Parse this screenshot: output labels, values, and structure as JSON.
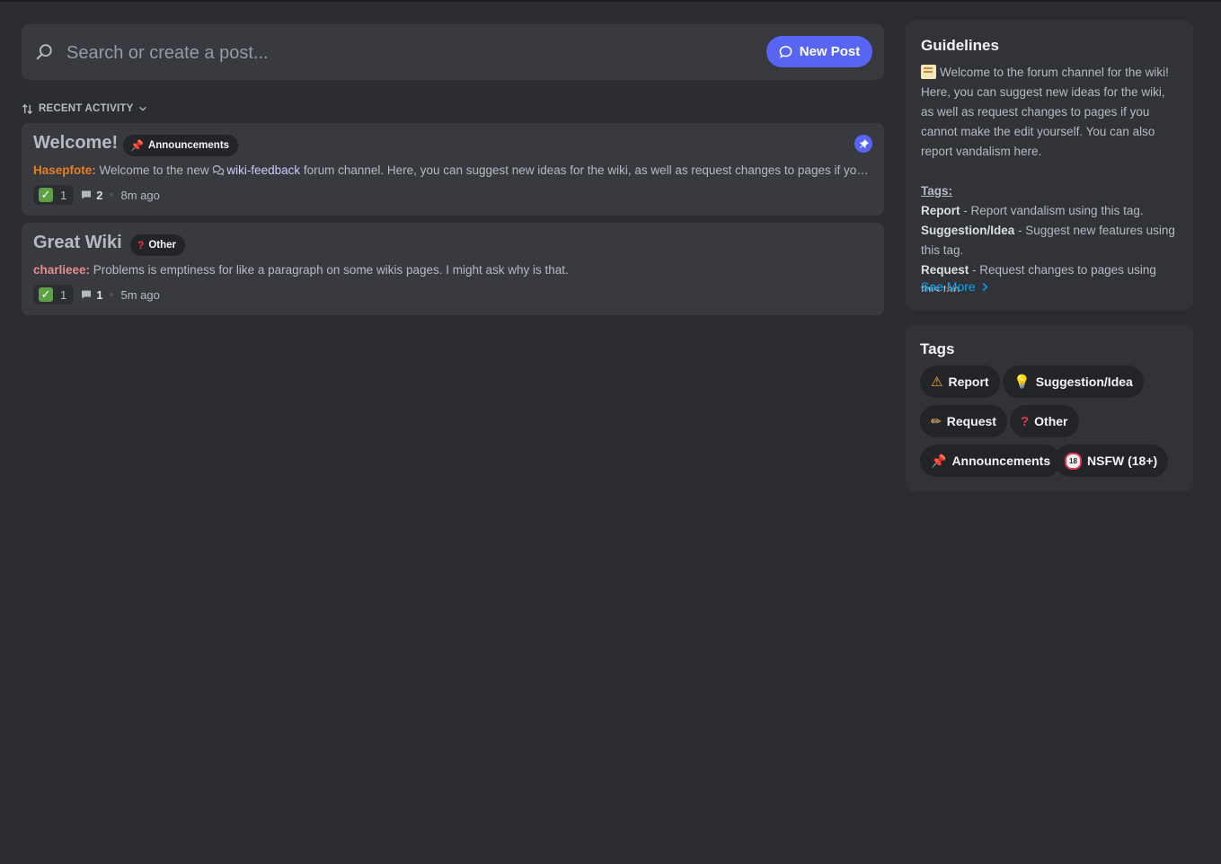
{
  "search": {
    "placeholder": "Search or create a post...",
    "new_post_label": "New Post",
    "icons": {
      "search": "search-icon",
      "new_post": "chat-bubble-icon"
    }
  },
  "sort": {
    "label": "RECENT ACTIVITY",
    "icon": "sort-arrows-icon"
  },
  "posts": [
    {
      "title": "Welcome!",
      "tag": {
        "icon": "pushpin-icon",
        "label": "Announcements"
      },
      "author": "Hasepfote",
      "preview_before": " Welcome to the new ",
      "channel": "wiki-feedback",
      "preview_after": " forum channel. Here, you can suggest new ideas for the wiki, as well as request changes to pages if you cannot make the edit yourself.",
      "reaction_count": "1",
      "message_count": "2",
      "time": "8m ago",
      "pinned": true
    },
    {
      "title": "Great Wiki",
      "tag": {
        "icon": "question-mark-icon",
        "label": "Other"
      },
      "author": "charlieee",
      "preview": " Problems is emptiness for like a paragraph on some wikis pages. I might ask why is that.",
      "reaction_count": "1",
      "message_count": "1",
      "time": "5m ago",
      "pinned": false
    }
  ],
  "guidelines": {
    "title": "Guidelines",
    "intro": "Welcome to the forum channel for the wiki! Here, you can suggest new ideas for the wiki, as well as request changes to pages if you cannot make the edit yourself. You can also report vandalism here.",
    "tags_heading": "Tags:",
    "rules": [
      {
        "name": "Report",
        "text": " -  Report vandalism using this tag."
      },
      {
        "name": "Suggestion/Idea",
        "text": " - Suggest new features using this tag."
      },
      {
        "name": "Request",
        "text": " - Request changes to pages using this tag."
      }
    ],
    "see_more": "See More"
  },
  "tags_panel": {
    "title": "Tags",
    "tags": [
      {
        "icon": "warning-icon",
        "label": "Report"
      },
      {
        "icon": "lightbulb-icon",
        "label": "Suggestion/Idea"
      },
      {
        "icon": "pencil-icon",
        "label": "Request"
      },
      {
        "icon": "question-mark-icon",
        "label": "Other"
      },
      {
        "icon": "pushpin-icon",
        "label": "Announcements"
      },
      {
        "icon": "eighteen-plus-icon",
        "label": "NSFW (18+)"
      }
    ]
  },
  "colors": {
    "background": "#2b2d31",
    "card": "#383a40",
    "accent": "#5865f2",
    "link": "#00a8fc",
    "author_orange": "#e67e22",
    "author_pink": "#e78c8c"
  }
}
